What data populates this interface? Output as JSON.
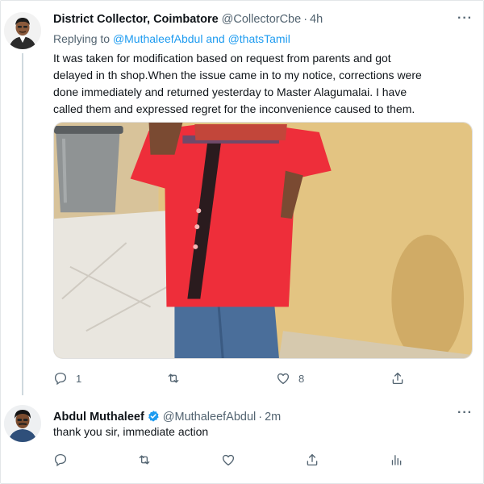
{
  "tweet1": {
    "author_name": "District Collector, Coimbatore",
    "handle": "@CollectorCbe",
    "separator": "·",
    "time": "4h",
    "more_label": "···",
    "replying_prefix": "Replying to",
    "replying_to": "@MuthaleefAbdul and @thatsTamil",
    "text_lines": [
      "It was taken for modification based on request from parents and got",
      "delayed in th shop.When the issue came in to my notice, corrections were",
      "done immediately and returned yesterday to Master Alagumalai. I have",
      "called them and expressed regret for the inconvenience caused to them."
    ],
    "media_icon": "photo-child-in-red-shirt",
    "actions": {
      "reply_count": "1",
      "retweet_count": "",
      "like_count": "8",
      "share_count": ""
    }
  },
  "tweet2": {
    "author_name": "Abdul Muthaleef",
    "handle": "@MuthaleefAbdul",
    "separator": "·",
    "time": "2m",
    "more_label": "···",
    "text": "thank you sir, immediate action",
    "actions": {
      "reply_icon": "reply-icon",
      "retweet_icon": "retweet-icon",
      "like_icon": "like-icon",
      "share_icon": "share-icon",
      "analytics_icon": "analytics-icon"
    }
  },
  "colors": {
    "link": "#1d9bf0",
    "secondary_text": "#536471",
    "verified": "#1d9bf0",
    "thread_line": "#cfd9de"
  }
}
